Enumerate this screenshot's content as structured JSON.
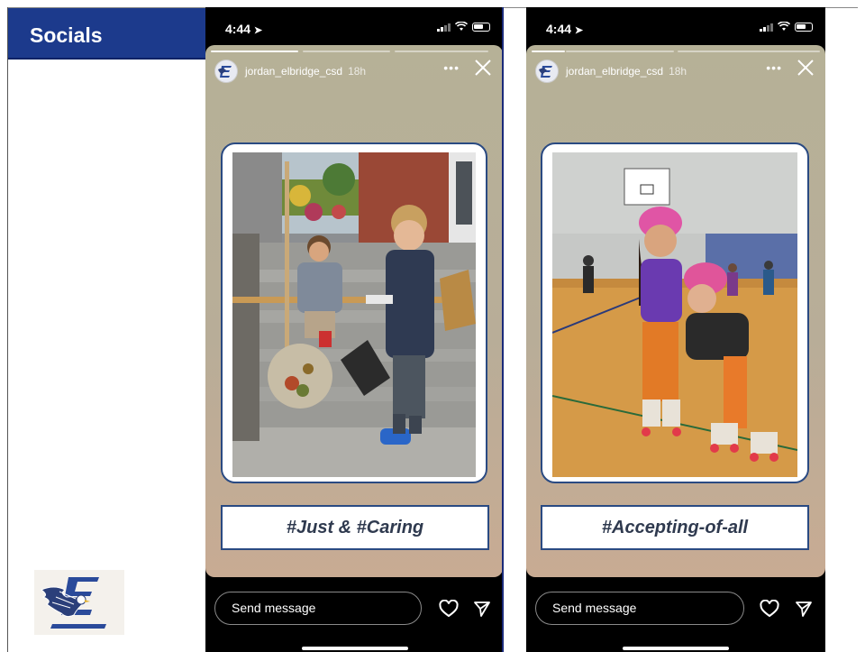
{
  "header": {
    "title": "Socials"
  },
  "stories": [
    {
      "time": "4:44",
      "username": "jordan_elbridge_csd",
      "age": "18h",
      "caption": "#Just & #Caring",
      "reply_placeholder": "Send message",
      "progress": {
        "segments": 3,
        "current": 1
      }
    },
    {
      "time": "4:44",
      "username": "jordan_elbridge_csd",
      "age": "18h",
      "caption": "#Accepting-of-all",
      "reply_placeholder": "Send message",
      "progress": {
        "segments": 3,
        "current": 1
      }
    }
  ],
  "icons": {
    "location": "location-arrow-icon",
    "signal": "cellular-signal-icon",
    "wifi": "wifi-icon",
    "battery": "battery-icon",
    "more": "more-options-icon",
    "close": "close-icon",
    "heart": "heart-icon",
    "send": "send-icon",
    "logo": "school-eagle-logo"
  },
  "colors": {
    "header_bg": "#1c3a8c",
    "frame_border": "#2a4a82",
    "caption_text": "#2f3a4f"
  }
}
